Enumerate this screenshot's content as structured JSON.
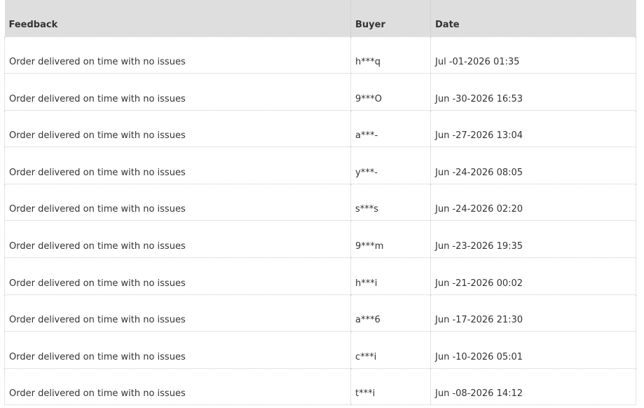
{
  "table": {
    "headers": {
      "feedback": "Feedback",
      "buyer": "Buyer",
      "date": "Date"
    },
    "rows": [
      {
        "feedback": "Order delivered on time with no issues",
        "buyer": "h***q",
        "date": "Jul -01-2026 01:35"
      },
      {
        "feedback": "Order delivered on time with no issues",
        "buyer": "9***O",
        "date": "Jun -30-2026 16:53"
      },
      {
        "feedback": "Order delivered on time with no issues",
        "buyer": "a***-",
        "date": "Jun -27-2026 13:04"
      },
      {
        "feedback": "Order delivered on time with no issues",
        "buyer": "y***-",
        "date": "Jun -24-2026 08:05"
      },
      {
        "feedback": "Order delivered on time with no issues",
        "buyer": "s***s",
        "date": "Jun -24-2026 02:20"
      },
      {
        "feedback": "Order delivered on time with no issues",
        "buyer": "9***m",
        "date": "Jun -23-2026 19:35"
      },
      {
        "feedback": "Order delivered on time with no issues",
        "buyer": "h***i",
        "date": "Jun -21-2026 00:02"
      },
      {
        "feedback": "Order delivered on time with no issues",
        "buyer": "a***6",
        "date": "Jun -17-2026 21:30"
      },
      {
        "feedback": "Order delivered on time with no issues",
        "buyer": "c***i",
        "date": "Jun -10-2026 05:01"
      },
      {
        "feedback": "Order delivered on time with no issues",
        "buyer": "t***i",
        "date": "Jun -08-2026 14:12"
      }
    ]
  },
  "colors": {
    "header_background": "#dedede",
    "text": "#333333",
    "border": "#c8c8c8"
  }
}
